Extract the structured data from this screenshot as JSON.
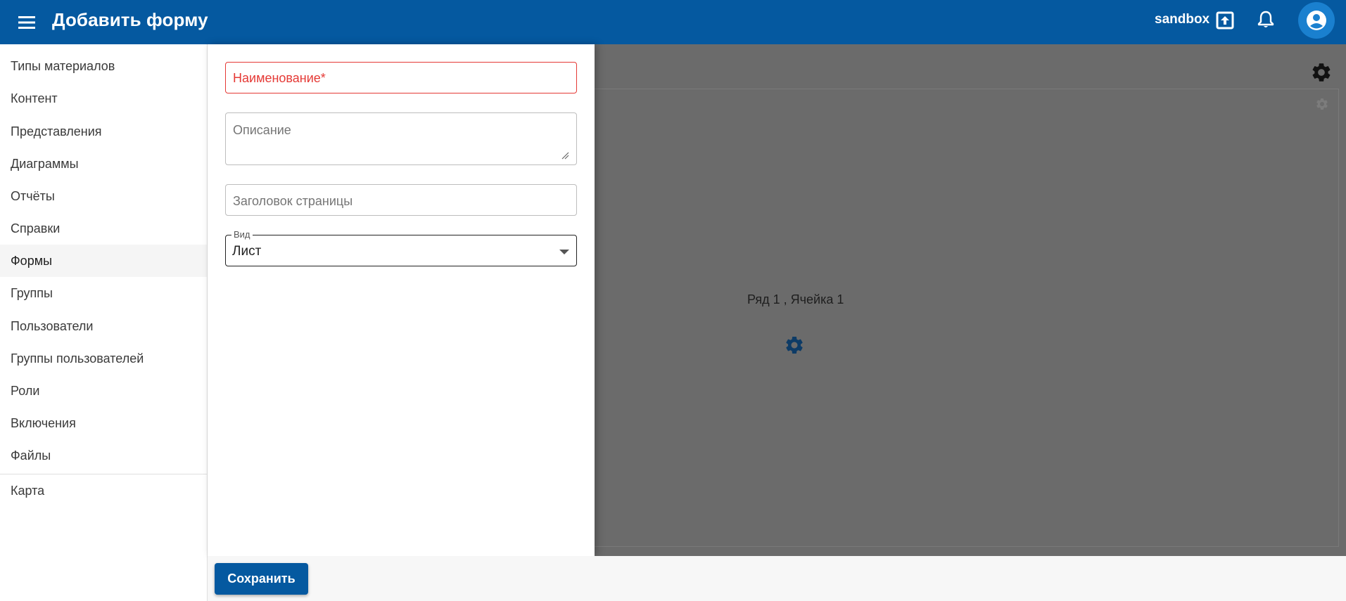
{
  "header": {
    "title": "Добавить форму",
    "environment": "sandbox",
    "menu_icon": "menu-icon",
    "env_icon": "upload-icon",
    "notifications_icon": "bell-icon",
    "account_icon": "account-circle-icon"
  },
  "sidebar": {
    "items": [
      {
        "label": "Типы материалов"
      },
      {
        "label": "Контент"
      },
      {
        "label": "Представления"
      },
      {
        "label": "Диаграммы"
      },
      {
        "label": "Отчёты"
      },
      {
        "label": "Справки"
      },
      {
        "label": "Формы",
        "active": true
      },
      {
        "label": "Группы"
      },
      {
        "label": "Пользователи"
      },
      {
        "label": "Группы пользователей"
      },
      {
        "label": "Роли"
      },
      {
        "label": "Включения"
      },
      {
        "label": "Файлы"
      },
      {
        "label": "Карта"
      }
    ]
  },
  "form": {
    "name_placeholder": "Наименование*",
    "description_placeholder": "Описание",
    "page_title_placeholder": "Заголовок страницы",
    "view_label": "Вид",
    "view_value": "Лист"
  },
  "canvas": {
    "cell_label": "Ряд 1 , Ячейка 1"
  },
  "footer": {
    "save_label": "Сохранить"
  },
  "colors": {
    "primary": "#0559a0",
    "avatar_bg": "#1a80cf",
    "error": "#e53935",
    "overlay": "#6b6b6b"
  }
}
